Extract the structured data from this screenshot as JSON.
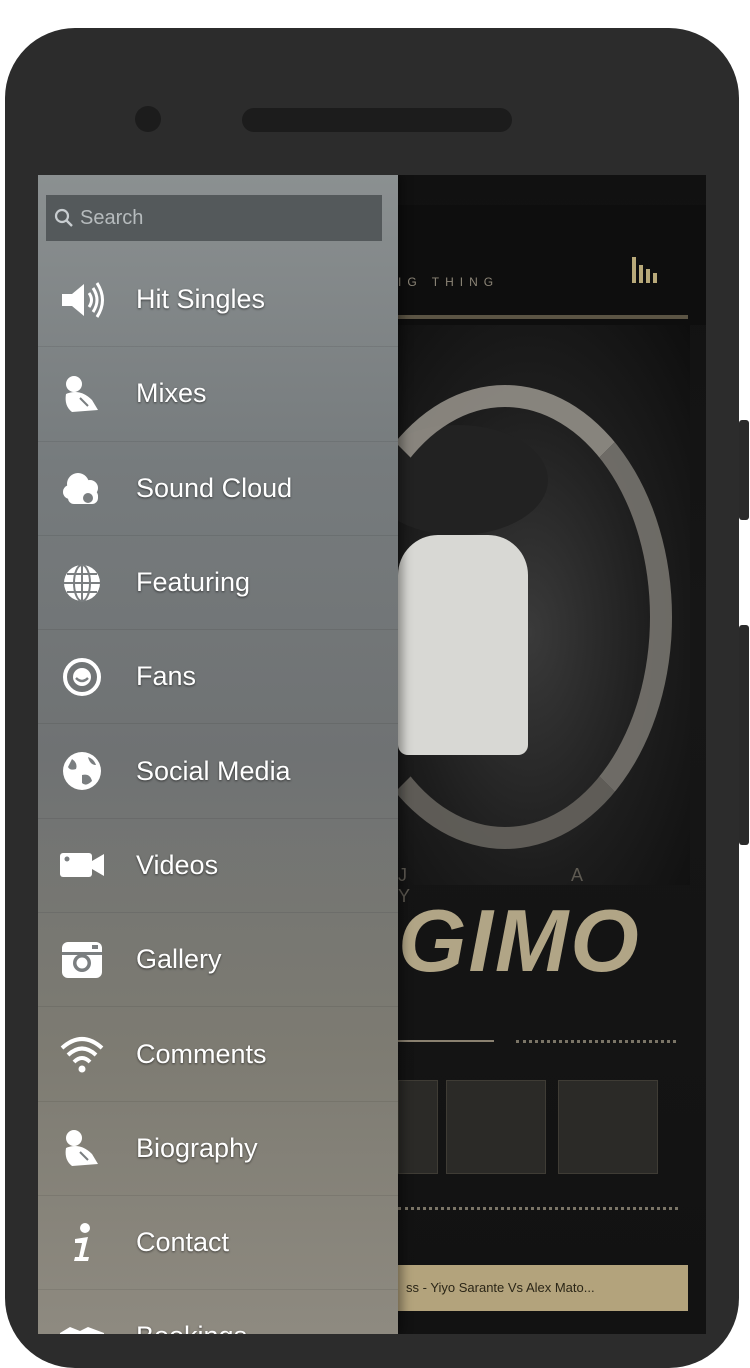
{
  "drawer": {
    "search_placeholder": "Search",
    "items": [
      {
        "label": "Hit Singles",
        "icon": "speaker-icon"
      },
      {
        "label": "Mixes",
        "icon": "person-icon"
      },
      {
        "label": "Sound Cloud",
        "icon": "cloud-icon"
      },
      {
        "label": "Featuring",
        "icon": "globe-grid-icon"
      },
      {
        "label": "Fans",
        "icon": "smiley-icon"
      },
      {
        "label": "Social Media",
        "icon": "earth-icon"
      },
      {
        "label": "Videos",
        "icon": "video-camera-icon"
      },
      {
        "label": "Gallery",
        "icon": "camera-icon"
      },
      {
        "label": "Comments",
        "icon": "wifi-icon"
      },
      {
        "label": "Biography",
        "icon": "person-icon"
      },
      {
        "label": "Contact",
        "icon": "info-icon"
      },
      {
        "label": "Bookings",
        "icon": "handshake-icon"
      }
    ]
  },
  "background": {
    "tagline": "IG THING",
    "artist_prefix": "J A Y",
    "artist_name": "GIMO",
    "now_playing": "ss - Yiyo Sarante Vs Alex Mato..."
  }
}
